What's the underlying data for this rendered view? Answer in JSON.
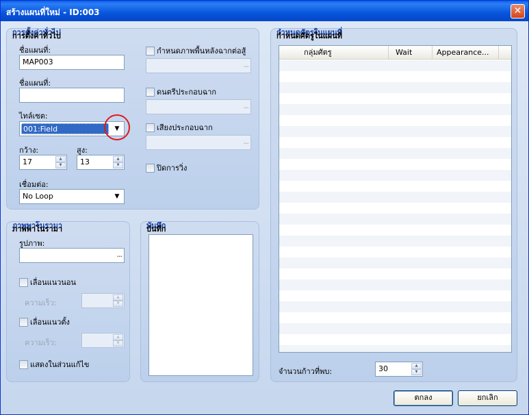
{
  "window": {
    "title": "สร้างแผนที่ใหม่ - ID:003",
    "close_glyph": "✕"
  },
  "general": {
    "title": "การตั้งค่าทั่วไป",
    "map_name_label": "ชื่อแผนที่:",
    "map_name_value": "MAP003",
    "display_name_label": "ชื่อแผนที่:",
    "display_name_value": "",
    "tileset_label": "ไทล์เซต:",
    "tileset_value": "001:Field",
    "width_label": "กว้าง:",
    "width_value": "17",
    "height_label": "สูง:",
    "height_value": "13",
    "loop_label": "เชื่อมต่อ:",
    "loop_value": "No Loop",
    "battle_bg_label": "กำหนดภาพพื้นหลังฉากต่อสู้",
    "bgm_label": "ดนตรีประกอบฉาก",
    "bgs_label": "เสียงประกอบฉาก",
    "disable_dash_label": "ปิดการวิ่ง"
  },
  "panorama": {
    "title": "ภาพพาโนรามา",
    "image_label": "รูปภาพ:",
    "image_value": "",
    "hscroll_label": "เลื่อนแนวนอน",
    "hspeed_label": "ความเร็ว:",
    "vscroll_label": "เลื่อนแนวตั้ง",
    "vspeed_label": "ความเร็ว:",
    "show_in_editor_label": "แสดงในส่วนแก้ไข"
  },
  "notes": {
    "title": "บันทึก"
  },
  "encounters": {
    "title": "กำหนดศัตรูในแผนที่",
    "columns": [
      "กลุ่มศัตรู",
      "Wait",
      "Appearance..."
    ],
    "steps_label": "จำนวนก้าวที่พบ:",
    "steps_value": "30"
  },
  "buttons": {
    "ok": "ตกลง",
    "cancel": "ยกเลิก"
  },
  "icons": {
    "dropdown": "▼",
    "spin_up": "▲",
    "spin_down": "▼",
    "ellipsis": "...",
    "accent_highlight": "#e01818"
  }
}
